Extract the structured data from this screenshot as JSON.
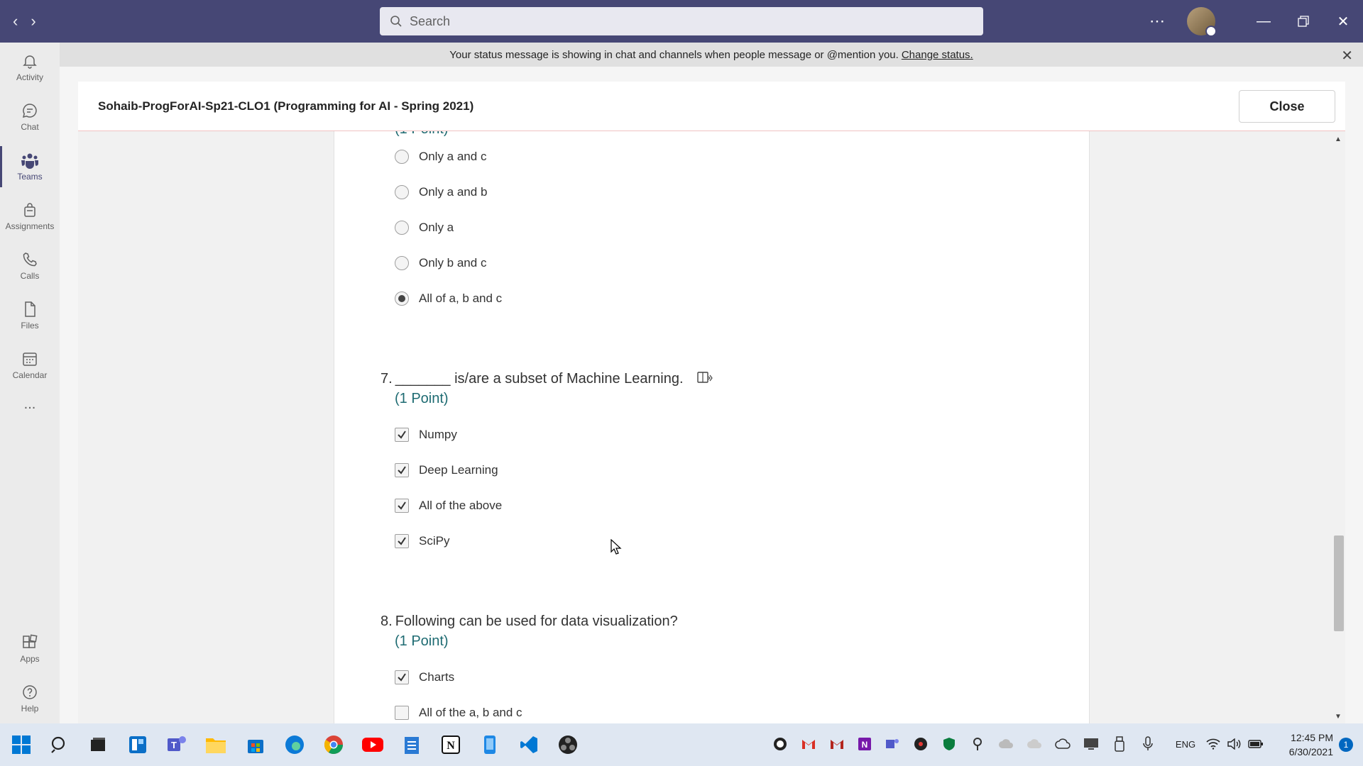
{
  "search": {
    "placeholder": "Search"
  },
  "rail": {
    "items": [
      {
        "label": "Activity",
        "icon": "bell-icon"
      },
      {
        "label": "Chat",
        "icon": "chat-icon"
      },
      {
        "label": "Teams",
        "icon": "teams-icon"
      },
      {
        "label": "Assignments",
        "icon": "assignments-icon"
      },
      {
        "label": "Calls",
        "icon": "phone-icon"
      },
      {
        "label": "Files",
        "icon": "file-icon"
      },
      {
        "label": "Calendar",
        "icon": "calendar-icon"
      },
      {
        "label": "Apps",
        "icon": "apps-icon"
      },
      {
        "label": "Help",
        "icon": "help-icon"
      }
    ],
    "more": "..."
  },
  "banner": {
    "text": "Your status message is showing in chat and channels when people message or @mention you.",
    "link": "Change status."
  },
  "form": {
    "title": "Sohaib-ProgForAI-Sp21-CLO1 (Programming for AI - Spring 2021)",
    "close_label": "Close",
    "q6_points_partial": "(1 Point)",
    "q6_options": [
      {
        "label": "Only a and c",
        "checked": false
      },
      {
        "label": "Only a and b",
        "checked": false
      },
      {
        "label": "Only a",
        "checked": false
      },
      {
        "label": "Only b and c",
        "checked": false
      },
      {
        "label": "All of a, b and c",
        "checked": true
      }
    ],
    "q7": {
      "number": "7.",
      "text": "_______ is/are a subset of Machine Learning.",
      "points": "(1 Point)",
      "options": [
        {
          "label": "Numpy",
          "checked": true
        },
        {
          "label": "Deep Learning",
          "checked": true
        },
        {
          "label": "All of the above",
          "checked": true
        },
        {
          "label": "SciPy",
          "checked": true
        }
      ]
    },
    "q8": {
      "number": "8.",
      "text": "Following can be used for data visualization?",
      "points": "(1 Point)",
      "options": [
        {
          "label": "Charts",
          "checked": true
        },
        {
          "label": "All of the a, b and c",
          "checked": false
        }
      ]
    }
  },
  "taskbar": {
    "language": "ENG",
    "time": "12:45 PM",
    "date": "6/30/2021",
    "notifications": "1"
  }
}
